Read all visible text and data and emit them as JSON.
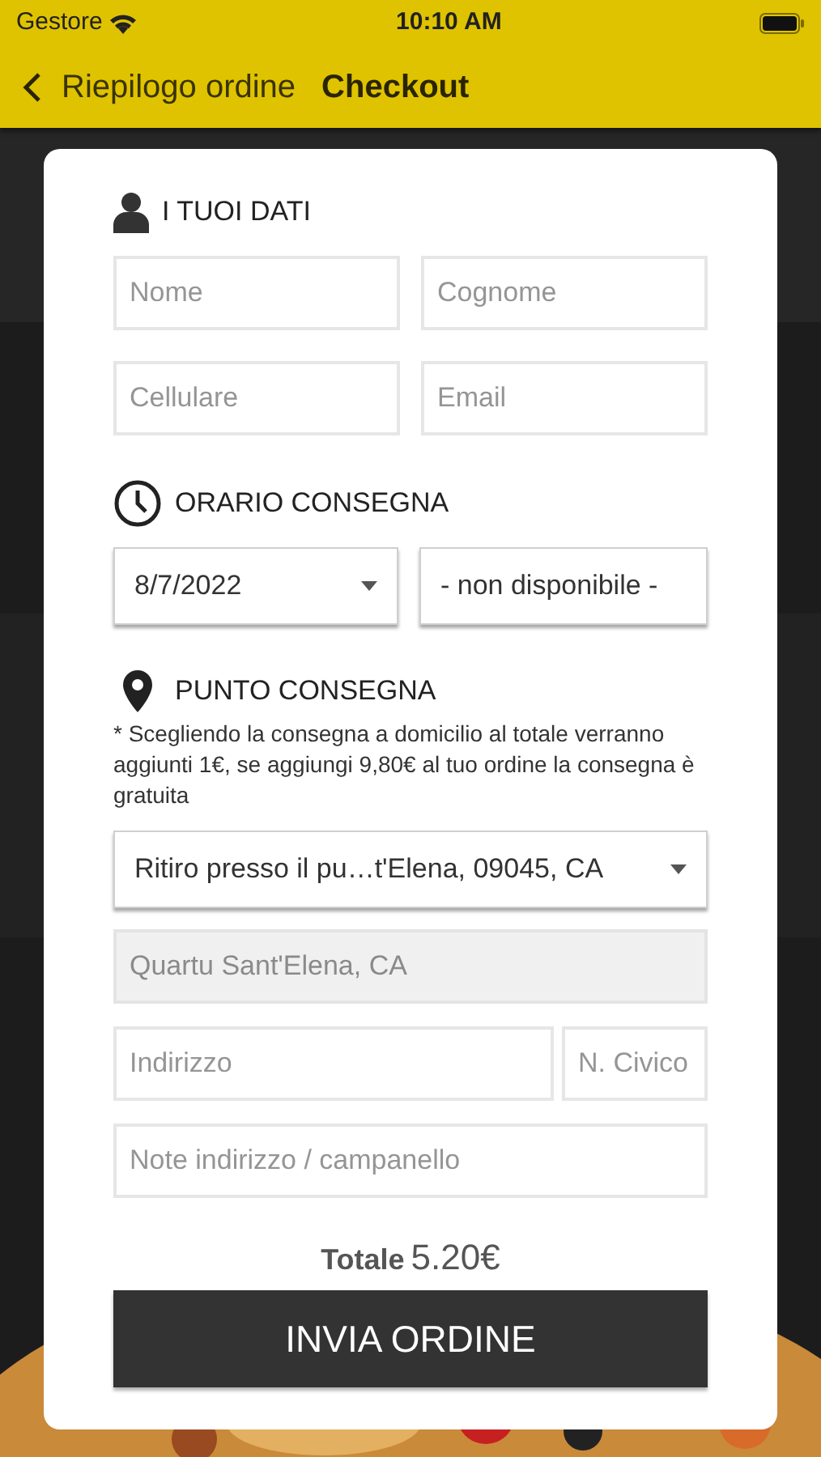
{
  "status_bar": {
    "carrier": "Gestore",
    "time": "10:10 AM"
  },
  "nav": {
    "back_label": "Riepilogo ordine",
    "title": "Checkout"
  },
  "personal": {
    "heading": "I TUOI DATI",
    "fields": [
      {
        "placeholder": "Nome"
      },
      {
        "placeholder": "Cognome"
      },
      {
        "placeholder": "Cellulare"
      },
      {
        "placeholder": "Email"
      }
    ]
  },
  "delivery_time": {
    "heading": "ORARIO CONSEGNA",
    "date": {
      "value": "8/7/2022",
      "dropdown": true
    },
    "slot": {
      "value": "- non disponibile -",
      "dropdown": false
    }
  },
  "delivery_point": {
    "heading": "PUNTO CONSEGNA",
    "note": "* Scegliendo la consegna a domicilio al totale verranno aggiunti 1€, se aggiungi 9,80€ al tuo ordine la consegna è gratuita",
    "select": {
      "value": "Ritiro presso il pu…t'Elena, 09045, CA",
      "dropdown": true
    },
    "fields": [
      {
        "placeholder": "Quartu Sant'Elena, CA",
        "disabled": true
      },
      {
        "placeholder": "Indirizzo",
        "disabled": false
      },
      {
        "placeholder": "N. Civico",
        "disabled": false
      },
      {
        "placeholder": "Note indirizzo / campanello",
        "disabled": false
      }
    ]
  },
  "total": {
    "label": "Totale",
    "amount": "5.20€"
  },
  "submit": {
    "label": "INVIA ORDINE"
  }
}
